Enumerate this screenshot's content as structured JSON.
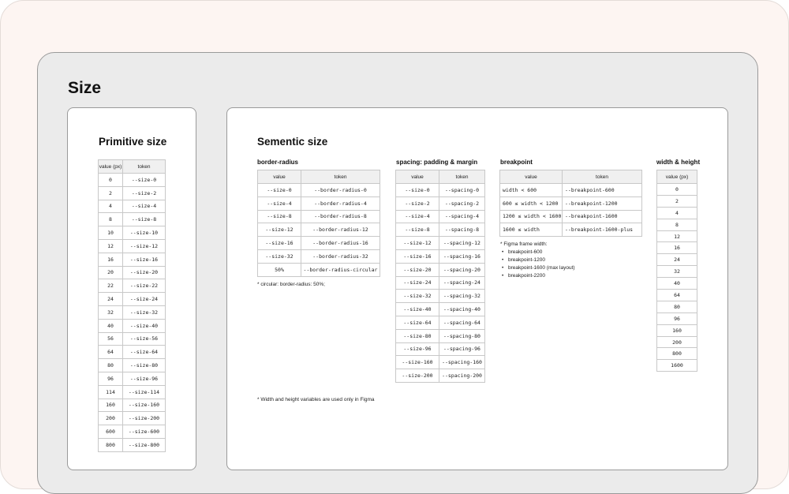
{
  "page": {
    "title": "Size"
  },
  "primitive": {
    "title": "Primitive size",
    "headers": [
      "value (px)",
      "token"
    ],
    "rows": [
      [
        "0",
        "--size-0"
      ],
      [
        "2",
        "--size-2"
      ],
      [
        "4",
        "--size-4"
      ],
      [
        "8",
        "--size-8"
      ],
      [
        "10",
        "--size-10"
      ],
      [
        "12",
        "--size-12"
      ],
      [
        "16",
        "--size-16"
      ],
      [
        "20",
        "--size-20"
      ],
      [
        "22",
        "--size-22"
      ],
      [
        "24",
        "--size-24"
      ],
      [
        "32",
        "--size-32"
      ],
      [
        "40",
        "--size-40"
      ],
      [
        "56",
        "--size-56"
      ],
      [
        "64",
        "--size-64"
      ],
      [
        "80",
        "--size-80"
      ],
      [
        "96",
        "--size-96"
      ],
      [
        "114",
        "--size-114"
      ],
      [
        "160",
        "--size-160"
      ],
      [
        "200",
        "--size-200"
      ],
      [
        "600",
        "--size-600"
      ],
      [
        "800",
        "--size-800"
      ]
    ]
  },
  "semantic": {
    "title": "Sementic size",
    "footnote": "* Width and height variables are used only in Figma",
    "border_radius": {
      "title": "border-radius",
      "headers": [
        "value",
        "token"
      ],
      "rows": [
        [
          "--size-0",
          "--border-radius-0"
        ],
        [
          "--size-4",
          "--border-radius-4"
        ],
        [
          "--size-8",
          "--border-radius-8"
        ],
        [
          "--size-12",
          "--border-radius-12"
        ],
        [
          "--size-16",
          "--border-radius-16"
        ],
        [
          "--size-32",
          "--border-radius-32"
        ],
        [
          "50%",
          "--border-radius-circular"
        ]
      ],
      "note": "* circular: border-radius: 50%;"
    },
    "spacing": {
      "title": "spacing: padding & margin",
      "headers": [
        "value",
        "token"
      ],
      "rows": [
        [
          "--size-0",
          "--spacing-0"
        ],
        [
          "--size-2",
          "--spacing-2"
        ],
        [
          "--size-4",
          "--spacing-4"
        ],
        [
          "--size-8",
          "--spacing-8"
        ],
        [
          "--size-12",
          "--spacing-12"
        ],
        [
          "--size-16",
          "--spacing-16"
        ],
        [
          "--size-20",
          "--spacing-20"
        ],
        [
          "--size-24",
          "--spacing-24"
        ],
        [
          "--size-32",
          "--spacing-32"
        ],
        [
          "--size-40",
          "--spacing-40"
        ],
        [
          "--size-64",
          "--spacing-64"
        ],
        [
          "--size-80",
          "--spacing-80"
        ],
        [
          "--size-96",
          "--spacing-96"
        ],
        [
          "--size-160",
          "--spacing-160"
        ],
        [
          "--size-200",
          "--spacing-200"
        ]
      ]
    },
    "breakpoint": {
      "title": "breakpoint",
      "headers": [
        "value",
        "token"
      ],
      "rows": [
        [
          "width < 600",
          "--breakpoint-600"
        ],
        [
          "600 ≤ width < 1200",
          "--breakpoint-1200"
        ],
        [
          "1200 ≤ width < 1600",
          "--breakpoint-1600"
        ],
        [
          "1600 ≤ width",
          "--breakpoint-1600-plus"
        ]
      ],
      "note": "* Figma frame width:",
      "bullets": [
        "breakpoint-600",
        "breakpoint-1200",
        "breakpoint-1600 (max layout)",
        "breakpoint-2200"
      ]
    },
    "width_height": {
      "title": "width & height",
      "headers": [
        "value (px)"
      ],
      "rows": [
        [
          "0"
        ],
        [
          "2"
        ],
        [
          "4"
        ],
        [
          "8"
        ],
        [
          "12"
        ],
        [
          "16"
        ],
        [
          "24"
        ],
        [
          "32"
        ],
        [
          "40"
        ],
        [
          "64"
        ],
        [
          "80"
        ],
        [
          "96"
        ],
        [
          "160"
        ],
        [
          "200"
        ],
        [
          "800"
        ],
        [
          "1600"
        ]
      ]
    }
  }
}
